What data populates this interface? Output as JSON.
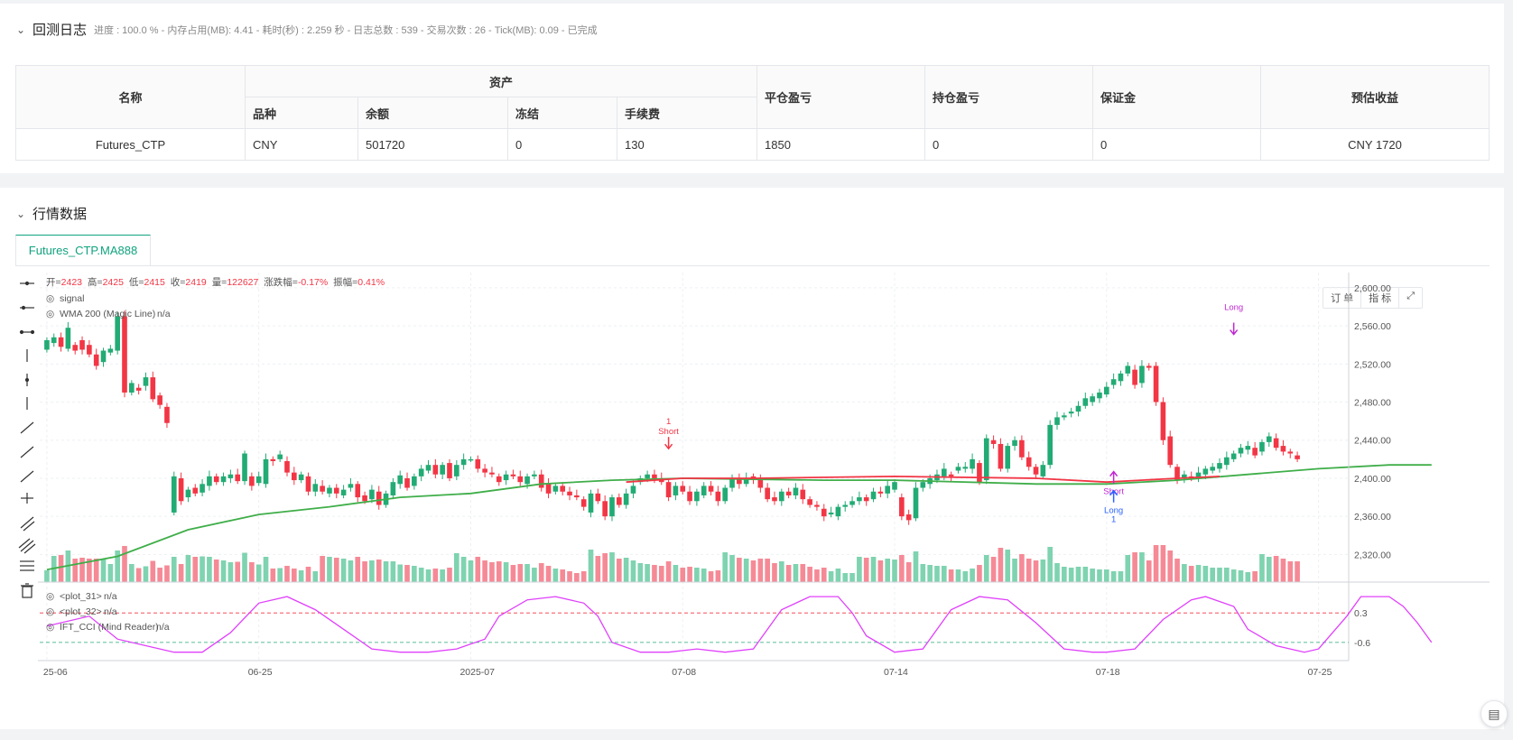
{
  "log": {
    "title": "回测日志",
    "subtitle": "进度 : 100.0 % - 内存占用(MB): 4.41 - 耗时(秒) : 2.259 秒 - 日志总数 : 539 - 交易次数 : 26 - Tick(MB): 0.09 - 已完成"
  },
  "table": {
    "h_name": "名称",
    "h_assets": "资产",
    "h_close_pl": "平仓盈亏",
    "h_hold_pl": "持仓盈亏",
    "h_margin": "保证金",
    "h_est": "预估收益",
    "h_variety": "品种",
    "h_balance": "余额",
    "h_frozen": "冻结",
    "h_fee": "手续费",
    "row": {
      "name": "Futures_CTP",
      "variety": "CNY",
      "balance": "501720",
      "frozen": "0",
      "fee": "130",
      "close_pl": "1850",
      "hold_pl": "0",
      "margin": "0",
      "est": "CNY 1720"
    }
  },
  "market": {
    "title": "行情数据",
    "tab": "Futures_CTP.MA888"
  },
  "toolbar": {
    "order": "订 单",
    "indicator": "指 标"
  },
  "legend": {
    "open_l": "开=",
    "open": "2423",
    "high_l": "高=",
    "high": "2425",
    "low_l": "低=",
    "low": "2415",
    "close_l": "收=",
    "close": "2419",
    "vol_l": "量=",
    "vol": "122627",
    "chg_l": "涨跌幅=",
    "chg": "-0.17%",
    "amp_l": "振幅=",
    "amp": "0.41%",
    "signal": "signal",
    "wma": "WMA 200 (Magic Line)",
    "na": "n/a",
    "plot31": "<plot_31>",
    "plot32": "<plot_32>",
    "ift": "IFT_CCI (Mind Reader)"
  },
  "chart_data": {
    "type": "candlestick",
    "y_ticks": [
      "2,600.00",
      "2,560.00",
      "2,520.00",
      "2,480.00",
      "2,440.00",
      "2,400.00",
      "2,360.00",
      "2,320.00"
    ],
    "y_tick_values": [
      2600,
      2560,
      2520,
      2480,
      2440,
      2400,
      2360,
      2320
    ],
    "ylim": [
      2291,
      2616
    ],
    "osc_ticks": [
      "0.3",
      "-0.6"
    ],
    "osc_tick_values": [
      0.3,
      -0.6
    ],
    "osc_ylim": [
      -1.1,
      1.05
    ],
    "x_labels": [
      "25-06",
      "06-25",
      "2025-07",
      "07-08",
      "07-14",
      "07-18",
      "07-25"
    ],
    "x_label_index": [
      0,
      30,
      60,
      90,
      120,
      150,
      180
    ],
    "candles": [
      [
        2535,
        2545
      ],
      [
        2542,
        2548
      ],
      [
        2548,
        2538
      ],
      [
        2536,
        2558
      ],
      [
        2540,
        2534
      ],
      [
        2545,
        2535
      ],
      [
        2540,
        2530
      ],
      [
        2530,
        2518
      ],
      [
        2522,
        2534
      ],
      [
        2532,
        2536
      ],
      [
        2534,
        2570
      ],
      [
        2570,
        2490
      ],
      [
        2490,
        2500
      ],
      [
        2495,
        2492
      ],
      [
        2497,
        2506
      ],
      [
        2506,
        2483
      ],
      [
        2487,
        2477
      ],
      [
        2475,
        2458
      ],
      [
        2364,
        2402
      ],
      [
        2400,
        2376
      ],
      [
        2380,
        2388
      ],
      [
        2390,
        2384
      ],
      [
        2385,
        2394
      ],
      [
        2392,
        2402
      ],
      [
        2402,
        2396
      ],
      [
        2396,
        2402
      ],
      [
        2400,
        2404
      ],
      [
        2404,
        2397
      ],
      [
        2397,
        2426
      ],
      [
        2402,
        2392
      ],
      [
        2395,
        2402
      ],
      [
        2394,
        2420
      ],
      [
        2420,
        2418
      ],
      [
        2420,
        2425
      ],
      [
        2418,
        2406
      ],
      [
        2406,
        2398
      ],
      [
        2398,
        2404
      ],
      [
        2402,
        2386
      ],
      [
        2386,
        2394
      ],
      [
        2392,
        2386
      ],
      [
        2384,
        2390
      ],
      [
        2390,
        2384
      ],
      [
        2382,
        2388
      ],
      [
        2390,
        2394
      ],
      [
        2394,
        2380
      ],
      [
        2382,
        2376
      ],
      [
        2378,
        2388
      ],
      [
        2386,
        2372
      ],
      [
        2372,
        2384
      ],
      [
        2382,
        2396
      ],
      [
        2394,
        2403
      ],
      [
        2400,
        2390
      ],
      [
        2392,
        2402
      ],
      [
        2402,
        2410
      ],
      [
        2408,
        2414
      ],
      [
        2414,
        2404
      ],
      [
        2404,
        2414
      ],
      [
        2416,
        2400
      ],
      [
        2402,
        2414
      ],
      [
        2414,
        2420
      ],
      [
        2420,
        2420
      ],
      [
        2420,
        2410
      ],
      [
        2410,
        2406
      ],
      [
        2406,
        2404
      ],
      [
        2402,
        2396
      ],
      [
        2398,
        2404
      ],
      [
        2404,
        2402
      ],
      [
        2402,
        2396
      ],
      [
        2394,
        2402
      ],
      [
        2402,
        2404
      ],
      [
        2404,
        2390
      ],
      [
        2394,
        2384
      ],
      [
        2386,
        2392
      ],
      [
        2392,
        2386
      ],
      [
        2386,
        2382
      ],
      [
        2382,
        2380
      ],
      [
        2378,
        2370
      ],
      [
        2364,
        2384
      ],
      [
        2384,
        2376
      ],
      [
        2376,
        2360
      ],
      [
        2360,
        2380
      ],
      [
        2380,
        2372
      ],
      [
        2372,
        2384
      ],
      [
        2384,
        2392
      ],
      [
        2396,
        2400
      ],
      [
        2400,
        2404
      ],
      [
        2404,
        2400
      ],
      [
        2400,
        2396
      ],
      [
        2396,
        2380
      ],
      [
        2382,
        2392
      ],
      [
        2392,
        2386
      ],
      [
        2386,
        2376
      ],
      [
        2376,
        2386
      ],
      [
        2382,
        2392
      ],
      [
        2392,
        2386
      ],
      [
        2386,
        2376
      ],
      [
        2376,
        2390
      ],
      [
        2390,
        2400
      ],
      [
        2400,
        2394
      ],
      [
        2394,
        2400
      ],
      [
        2402,
        2398
      ],
      [
        2400,
        2390
      ],
      [
        2390,
        2378
      ],
      [
        2380,
        2376
      ],
      [
        2376,
        2386
      ],
      [
        2386,
        2382
      ],
      [
        2382,
        2390
      ],
      [
        2388,
        2378
      ],
      [
        2378,
        2372
      ],
      [
        2372,
        2370
      ],
      [
        2368,
        2360
      ],
      [
        2362,
        2364
      ],
      [
        2360,
        2370
      ],
      [
        2370,
        2372
      ],
      [
        2372,
        2376
      ],
      [
        2376,
        2380
      ],
      [
        2380,
        2376
      ],
      [
        2378,
        2386
      ],
      [
        2386,
        2384
      ],
      [
        2384,
        2392
      ],
      [
        2388,
        2396
      ],
      [
        2380,
        2360
      ],
      [
        2362,
        2356
      ],
      [
        2358,
        2390
      ],
      [
        2390,
        2396
      ],
      [
        2394,
        2400
      ],
      [
        2398,
        2404
      ],
      [
        2402,
        2410
      ],
      [
        2404,
        2402
      ],
      [
        2408,
        2412
      ],
      [
        2410,
        2412
      ],
      [
        2410,
        2420
      ],
      [
        2416,
        2396
      ],
      [
        2398,
        2442
      ],
      [
        2440,
        2436
      ],
      [
        2436,
        2410
      ],
      [
        2410,
        2434
      ],
      [
        2434,
        2440
      ],
      [
        2440,
        2422
      ],
      [
        2422,
        2412
      ],
      [
        2412,
        2404
      ],
      [
        2402,
        2414
      ],
      [
        2414,
        2456
      ],
      [
        2456,
        2464
      ],
      [
        2464,
        2466
      ],
      [
        2468,
        2470
      ],
      [
        2470,
        2476
      ],
      [
        2476,
        2484
      ],
      [
        2480,
        2486
      ],
      [
        2484,
        2490
      ],
      [
        2488,
        2496
      ],
      [
        2498,
        2504
      ],
      [
        2502,
        2510
      ],
      [
        2510,
        2518
      ],
      [
        2514,
        2498
      ],
      [
        2500,
        2518
      ],
      [
        2518,
        2516
      ],
      [
        2518,
        2480
      ],
      [
        2480,
        2440
      ],
      [
        2444,
        2414
      ],
      [
        2412,
        2398
      ],
      [
        2400,
        2404
      ],
      [
        2402,
        2400
      ],
      [
        2400,
        2406
      ],
      [
        2404,
        2410
      ],
      [
        2408,
        2412
      ],
      [
        2410,
        2416
      ],
      [
        2414,
        2422
      ],
      [
        2420,
        2426
      ],
      [
        2426,
        2432
      ],
      [
        2430,
        2434
      ],
      [
        2432,
        2424
      ],
      [
        2428,
        2438
      ],
      [
        2438,
        2444
      ],
      [
        2442,
        2432
      ],
      [
        2434,
        2428
      ],
      [
        2428,
        2426
      ],
      [
        2424,
        2420
      ]
    ],
    "wma": [
      [
        0,
        2304
      ],
      [
        10,
        2318
      ],
      [
        20,
        2346
      ],
      [
        30,
        2362
      ],
      [
        40,
        2370
      ],
      [
        50,
        2380
      ],
      [
        60,
        2384
      ],
      [
        70,
        2394
      ],
      [
        80,
        2398
      ],
      [
        90,
        2400
      ],
      [
        110,
        2398
      ],
      [
        120,
        2398
      ],
      [
        140,
        2394
      ],
      [
        150,
        2394
      ],
      [
        160,
        2398
      ],
      [
        170,
        2404
      ],
      [
        180,
        2410
      ],
      [
        190,
        2414
      ],
      [
        196,
        2414
      ]
    ],
    "red_line": [
      [
        82,
        2396
      ],
      [
        90,
        2400
      ],
      [
        100,
        2400
      ],
      [
        120,
        2402
      ],
      [
        140,
        2400
      ],
      [
        150,
        2396
      ],
      [
        160,
        2400
      ],
      [
        166,
        2402
      ]
    ],
    "osc": [
      [
        0,
        -0.1
      ],
      [
        6,
        0.2
      ],
      [
        10,
        -0.5
      ],
      [
        14,
        -0.7
      ],
      [
        18,
        -0.9
      ],
      [
        22,
        -0.9
      ],
      [
        26,
        -0.3
      ],
      [
        30,
        0.6
      ],
      [
        34,
        0.8
      ],
      [
        38,
        0.4
      ],
      [
        42,
        -0.2
      ],
      [
        46,
        -0.8
      ],
      [
        50,
        -0.9
      ],
      [
        54,
        -0.9
      ],
      [
        58,
        -0.8
      ],
      [
        62,
        -0.5
      ],
      [
        64,
        0.2
      ],
      [
        68,
        0.7
      ],
      [
        72,
        0.8
      ],
      [
        76,
        0.6
      ],
      [
        78,
        0.2
      ],
      [
        80,
        -0.6
      ],
      [
        84,
        -0.9
      ],
      [
        88,
        -0.9
      ],
      [
        92,
        -0.8
      ],
      [
        96,
        -0.9
      ],
      [
        100,
        -0.8
      ],
      [
        104,
        0.4
      ],
      [
        108,
        0.8
      ],
      [
        112,
        0.8
      ],
      [
        114,
        0.3
      ],
      [
        116,
        -0.4
      ],
      [
        120,
        -0.9
      ],
      [
        124,
        -0.8
      ],
      [
        128,
        0.4
      ],
      [
        132,
        0.8
      ],
      [
        136,
        0.7
      ],
      [
        140,
        0.0
      ],
      [
        144,
        -0.8
      ],
      [
        148,
        -0.9
      ],
      [
        150,
        -0.9
      ],
      [
        154,
        -0.8
      ],
      [
        158,
        0.1
      ],
      [
        162,
        0.7
      ],
      [
        164,
        0.8
      ],
      [
        168,
        0.5
      ],
      [
        170,
        -0.2
      ],
      [
        174,
        -0.7
      ],
      [
        178,
        -0.9
      ],
      [
        180,
        -0.8
      ],
      [
        184,
        0.2
      ],
      [
        186,
        0.8
      ],
      [
        190,
        0.8
      ],
      [
        192,
        0.5
      ],
      [
        194,
        0.0
      ],
      [
        196,
        -0.6
      ]
    ],
    "markers": [
      {
        "label": "1",
        "label2": "Short",
        "index": 88,
        "price": 2432,
        "color": "#f23645",
        "dir": "down"
      },
      {
        "label": "Short",
        "index": 151,
        "price": 2406,
        "color": "#c026d3",
        "dir": "up"
      },
      {
        "label": "Long",
        "label2": "1",
        "index": 151,
        "price": 2386,
        "color": "#2962ff",
        "dir": "up"
      },
      {
        "label": "Long",
        "index": 168,
        "price": 2552,
        "color": "#c026d3",
        "dir": "down"
      }
    ]
  }
}
